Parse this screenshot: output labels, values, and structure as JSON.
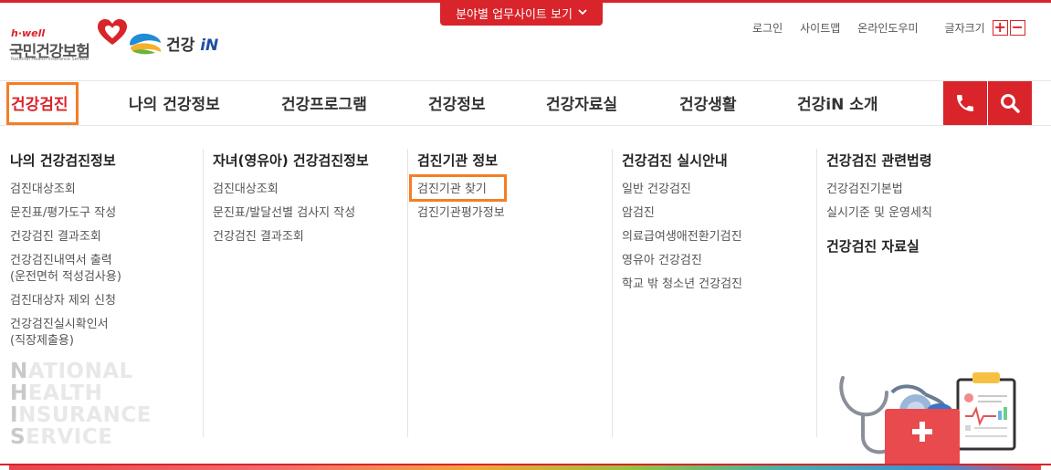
{
  "site_toggle": {
    "label": "분야별 업무사이트 보기"
  },
  "logo": {
    "hwell": "h·well",
    "name": "국민건강보험",
    "eng": "National Health Insurance Service",
    "gin_prefix": "건강",
    "gin_suffix": "iN"
  },
  "util": {
    "login": "로그인",
    "sitemap": "사이트맵",
    "online_help": "온라인도우미",
    "font_size": "글자크기",
    "font_plus": "+",
    "font_minus": "−"
  },
  "gnb": {
    "items": [
      {
        "label": "건강검진"
      },
      {
        "label": "나의 건강정보"
      },
      {
        "label": "건강프로그램"
      },
      {
        "label": "건강정보"
      },
      {
        "label": "건강자료실"
      },
      {
        "label": "건강생활"
      },
      {
        "label": "건강iN 소개"
      }
    ]
  },
  "mega": {
    "columns": [
      {
        "title": "나의 건강검진정보",
        "links": [
          "검진대상조회",
          "문진표/평가도구 작성",
          "건강검진 결과조회",
          "건강검진내역서 출력",
          "(운전면허 적성검사용)",
          "검진대상자 제외 신청",
          "건강검진실시확인서",
          "(직장제출용)"
        ]
      },
      {
        "title": "자녀(영유아) 건강검진정보",
        "links": [
          "검진대상조회",
          "문진표/발달선별 검사지 작성",
          "건강검진 결과조회"
        ]
      },
      {
        "title": "검진기관 정보",
        "links": [
          "검진기관 찾기",
          "검진기관평가정보"
        ]
      },
      {
        "title": "건강검진 실시안내",
        "links": [
          "일반 건강검진",
          "암검진",
          "의료급여생애전환기검진",
          "영유아 건강검진",
          "학교 밖 청소년 건강검진"
        ]
      },
      {
        "title": "건강검진 관련법령",
        "links": [
          "건강검진기본법",
          "실시기준 및 운영세칙"
        ],
        "title2": "건강검진 자료실"
      }
    ]
  },
  "watermark": {
    "lines": [
      {
        "first": "N",
        "rest": "ATIONAL"
      },
      {
        "first": "H",
        "rest": "EALTH"
      },
      {
        "first": "I",
        "rest": "NSURANCE"
      },
      {
        "first": "S",
        "rest": "ERVICE"
      }
    ]
  },
  "colors": {
    "brand_red": "#d8242a",
    "highlight_orange": "#f47e25"
  },
  "icons": {
    "phone": "phone-icon",
    "search": "search-icon",
    "chevron": "chevron-down-icon"
  }
}
